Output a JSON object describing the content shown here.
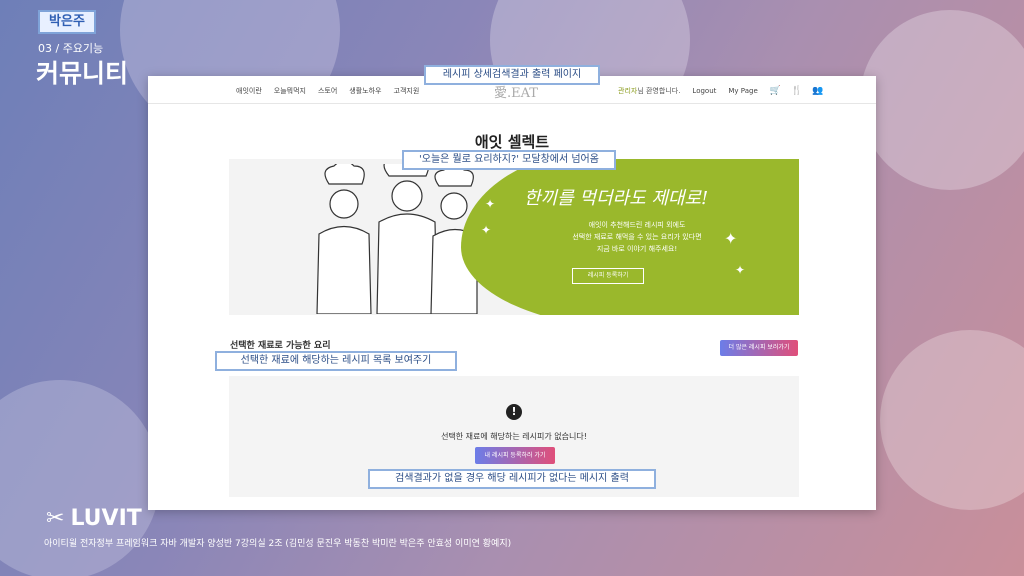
{
  "slide": {
    "author": "박은주",
    "section_number": "03 / 주요기능",
    "section_title": "커뮤니티",
    "footer": "아이티윌 전자정부 프레임워크 자바 개발자 양성반 7강의실 2조 (김민성 문진우 박동찬 박미란 박은주 안효성 이미연 황예지)",
    "brand": "LUVIT"
  },
  "callouts": {
    "top": "레시피 상세검색결과 출력 페이지",
    "banner": "'오늘은 뭘로 요리하지?' 모달창에서 넘어옴",
    "list": "선택한 재료에 해당하는 레시피 목록 보여주기",
    "empty": "검색결과가 없을 경우 해당 레시피가 없다는 메시지 출력"
  },
  "site": {
    "nav": [
      "애잇이란",
      "오늘뭐먹지",
      "스토어",
      "생활노하우",
      "고객지원"
    ],
    "logo": "愛.EAT",
    "welcome_name": "관리자",
    "welcome_suffix": "님 환영합니다.",
    "logout": "Logout",
    "mypage": "My Page",
    "icons": [
      "cart-icon",
      "utensils-icon",
      "users-icon"
    ],
    "page_title": "애잇 셀렉트",
    "banner": {
      "handwriting": "한끼를 먹더라도 제대로!",
      "line1": "애잇이 추천해드린 레시피 외에도",
      "line2": "선택한 재료로 해먹을 수 있는 요리가 있다면",
      "line3": "지금 바로 이야기 해주세요!",
      "cta": "레시피 등록하기"
    },
    "list_title": "선택한 재료로 가능한 요리",
    "more_button": "더 많은 레시피 보러가기",
    "empty_message": "선택한 재료에 해당하는 레시피가 없습니다!",
    "register_button": "내 레시피 등록하러 가기",
    "accent_green": "#9ab82c"
  }
}
